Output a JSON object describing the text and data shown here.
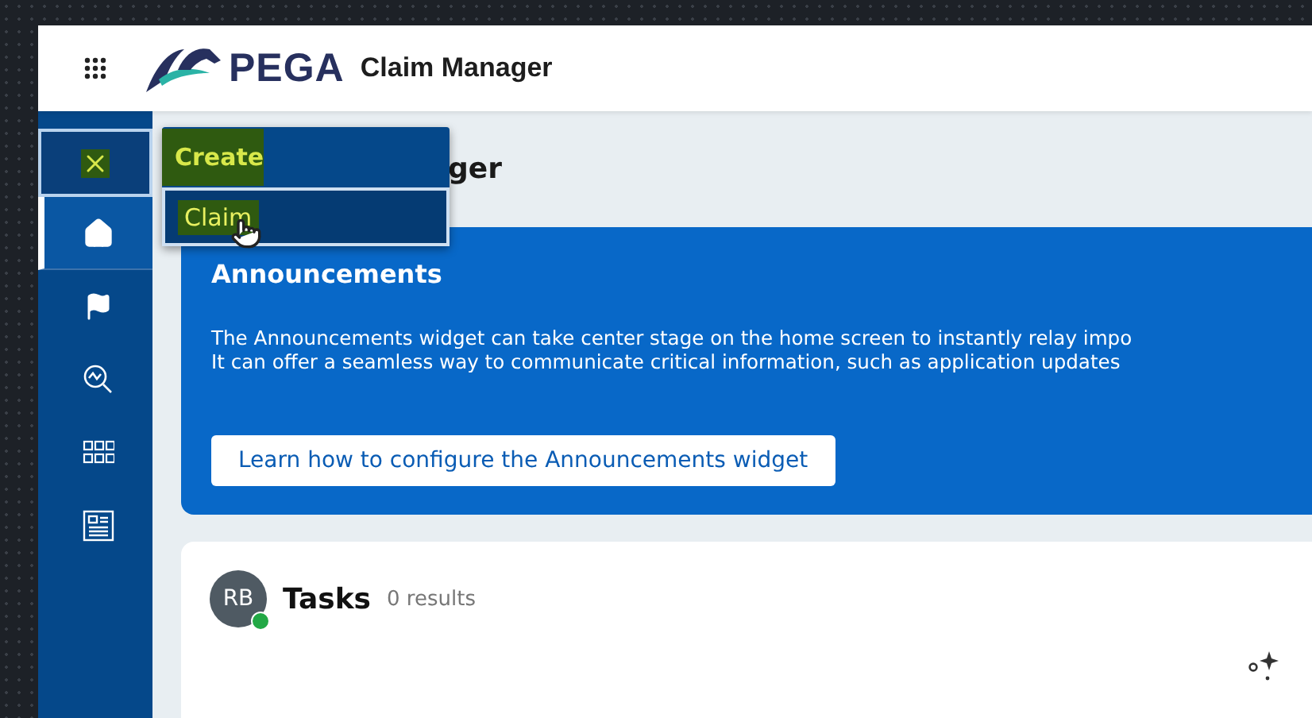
{
  "header": {
    "brand": "PEGA",
    "app_name": "Claim Manager"
  },
  "sidebar": {
    "close_highlighted": true,
    "items": [
      {
        "kind": "home",
        "selected": true
      },
      {
        "kind": "flag",
        "selected": false
      },
      {
        "kind": "analytics",
        "selected": false
      },
      {
        "kind": "grid",
        "selected": false
      },
      {
        "kind": "document",
        "selected": false
      }
    ]
  },
  "create_menu": {
    "title": "Create",
    "title_highlighted": true,
    "items": [
      {
        "label": "Claim",
        "selected": true,
        "highlighted": true
      }
    ]
  },
  "page_heading": "ger",
  "announcements": {
    "title": "Announcements",
    "lines": [
      "The Announcements widget can take center stage on the home screen to instantly relay impo",
      "It can offer a seamless way to communicate critical information, such as application updates"
    ],
    "button": "Learn how to configure the Announcements widget"
  },
  "tasks": {
    "avatar": "RB",
    "online": true,
    "title": "Tasks",
    "count": "0 results"
  }
}
